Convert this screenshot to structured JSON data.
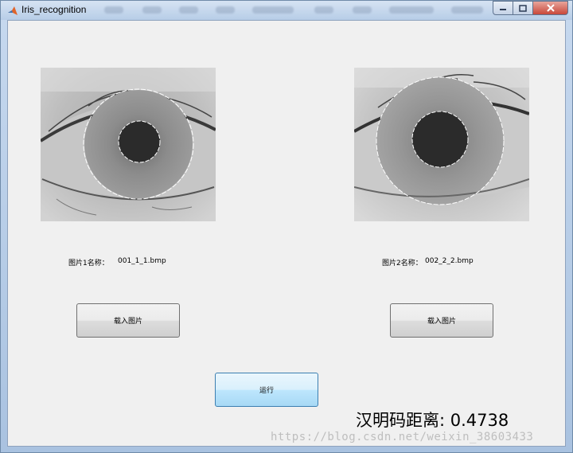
{
  "window": {
    "title": "Iris_recognition"
  },
  "image1": {
    "name_label": "图片1名称：",
    "file_name": "001_1_1.bmp",
    "load_button": "载入图片"
  },
  "image2": {
    "name_label": "图片2名称：",
    "file_name": "002_2_2.bmp",
    "load_button": "载入图片"
  },
  "run_button": "运行",
  "result": {
    "label": "汉明码距离",
    "separator": ":",
    "value": "0.4738"
  },
  "watermark": "https://blog.csdn.net/weixin_38603433",
  "icons": {
    "app": "matlab-icon",
    "minimize": "minimize-icon",
    "maximize": "maximize-icon",
    "close": "close-icon"
  }
}
